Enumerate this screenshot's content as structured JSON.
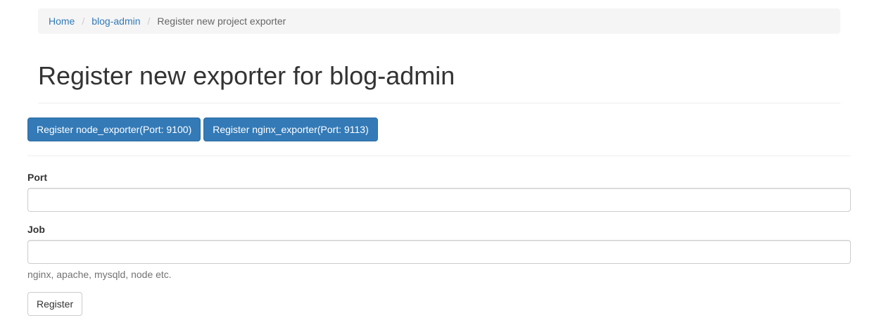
{
  "breadcrumb": {
    "items": [
      {
        "label": "Home",
        "link": true
      },
      {
        "label": "blog-admin",
        "link": true
      },
      {
        "label": "Register new project exporter",
        "link": false
      }
    ],
    "separator": "/"
  },
  "header": {
    "title": "Register new exporter for blog-admin"
  },
  "exporters": {
    "node_label": "Register node_exporter(Port: 9100)",
    "nginx_label": "Register nginx_exporter(Port: 9113)"
  },
  "form": {
    "port": {
      "label": "Port",
      "value": ""
    },
    "job": {
      "label": "Job",
      "value": "",
      "help": "nginx, apache, mysqld, node etc."
    },
    "submit_label": "Register"
  },
  "colors": {
    "primary": "#337ab7",
    "link": "#337ab7",
    "breadcrumb_bg": "#f5f5f5"
  }
}
